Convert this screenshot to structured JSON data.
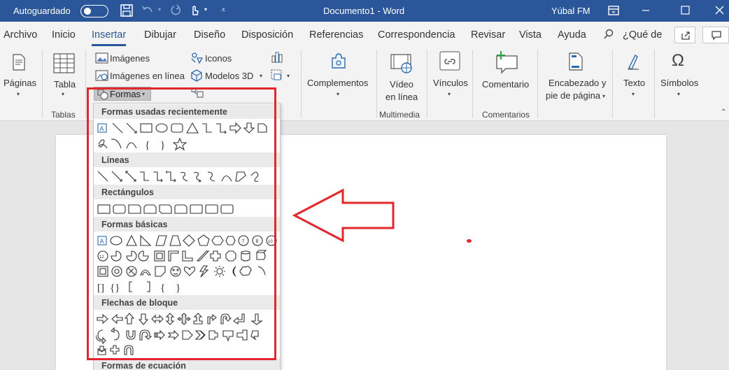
{
  "titlebar": {
    "autosave": "Autoguardado",
    "doc_title": "Documento1  -  Word",
    "user": "Yúbal FM"
  },
  "menu": {
    "tabs": [
      "Archivo",
      "Inicio",
      "Insertar",
      "Dibujar",
      "Diseño",
      "Disposición",
      "Referencias",
      "Correspondencia",
      "Revisar",
      "Vista",
      "Ayuda"
    ],
    "active_tab": "Insertar",
    "tell_me": "¿Qué de"
  },
  "ribbon": {
    "paginas": "Páginas",
    "tabla": "Tabla",
    "tablas_group": "Tablas",
    "imagenes": "Imágenes",
    "imagenes_linea": "Imágenes en línea",
    "formas": "Formas",
    "iconos": "Iconos",
    "modelos3d": "Modelos 3D",
    "complementos": "Complementos",
    "video1": "Vídeo",
    "video2": "en línea",
    "multimedia_group": "Multimedia",
    "vinculos": "Vínculos",
    "comentario": "Comentario",
    "comentarios_group": "Comentarios",
    "encabezado1": "Encabezado y",
    "encabezado2": "pie de página",
    "texto": "Texto",
    "simbolos": "Símbolos"
  },
  "shapes_menu": {
    "sections": [
      "Formas usadas recientemente",
      "Líneas",
      "Rectángulos",
      "Formas básicas",
      "Flechas de bloque",
      "Formas de ecuación"
    ]
  },
  "colors": {
    "title_bar": "#2b579a",
    "ribbon_bg": "#f3f3f3",
    "annotation_red": "#e3262b",
    "doc_bg": "#e6e6e6"
  }
}
